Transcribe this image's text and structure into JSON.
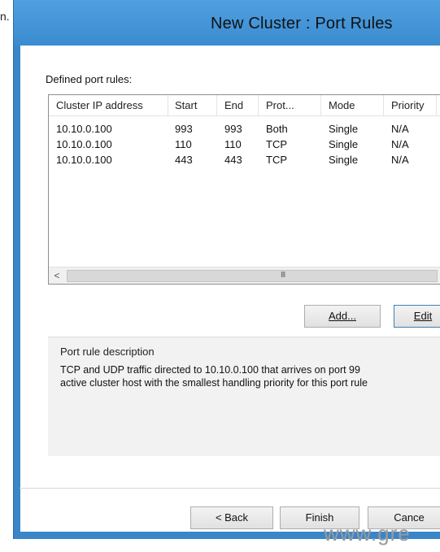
{
  "stray_text": "n.",
  "window": {
    "title": "New Cluster : Port Rules"
  },
  "port_rules": {
    "section_label": "Defined port rules:",
    "columns": [
      "Cluster IP address",
      "Start",
      "End",
      "Prot...",
      "Mode",
      "Priority"
    ],
    "rows": [
      [
        "10.10.0.100",
        "993",
        "993",
        "Both",
        "Single",
        "N/A"
      ],
      [
        "10.10.0.100",
        "110",
        "110",
        "TCP",
        "Single",
        "N/A"
      ],
      [
        "10.10.0.100",
        "443",
        "443",
        "TCP",
        "Single",
        "N/A"
      ]
    ],
    "scroll_left_glyph": "<",
    "scroll_grip_glyph": "III"
  },
  "buttons": {
    "add": "Add...",
    "edit": "Edit",
    "back": "< Back",
    "finish": "Finish",
    "cancel": "Cance"
  },
  "description": {
    "label": "Port rule description",
    "line1": "TCP and UDP traffic directed to 10.10.0.100 that arrives on port 99",
    "line2": "active cluster host with the smallest handling priority for this port rule"
  },
  "watermark": "www.gre"
}
